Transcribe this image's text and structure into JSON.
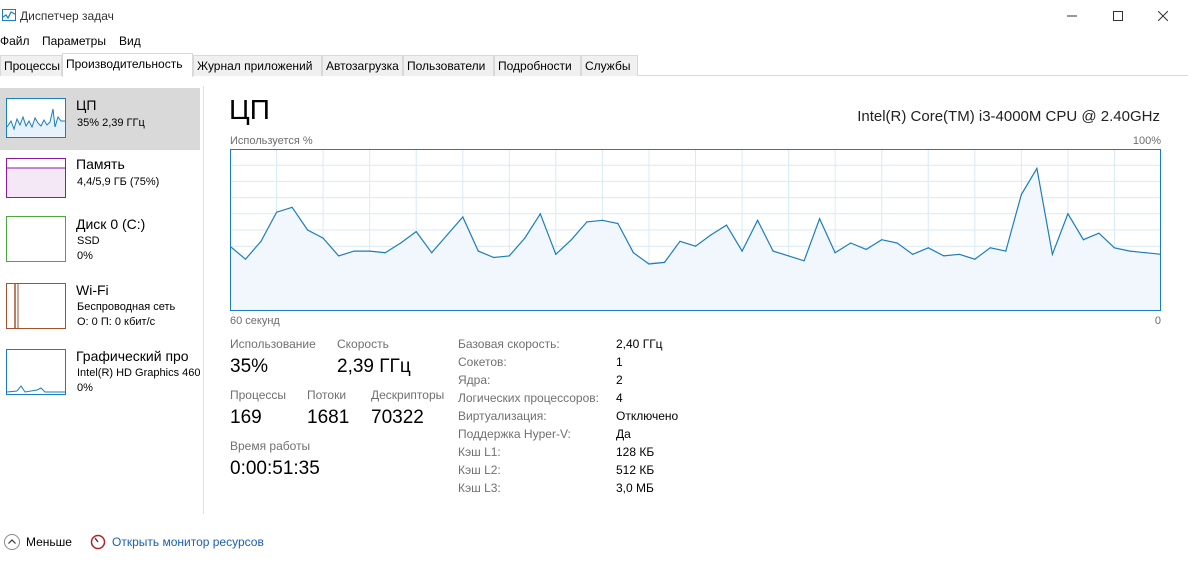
{
  "window": {
    "title": "Диспетчер задач",
    "app_icon": "task-manager-icon",
    "controls": [
      "minimize-icon",
      "maximize-icon",
      "close-icon"
    ]
  },
  "menu": [
    "Файл",
    "Параметры",
    "Вид"
  ],
  "tabs": [
    {
      "label": "Процессы",
      "active": false
    },
    {
      "label": "Производительность",
      "active": true
    },
    {
      "label": "Журнал приложений",
      "active": false
    },
    {
      "label": "Автозагрузка",
      "active": false
    },
    {
      "label": "Пользователи",
      "active": false
    },
    {
      "label": "Подробности",
      "active": false
    },
    {
      "label": "Службы",
      "active": false
    }
  ],
  "sidebar": [
    {
      "name": "ЦП",
      "line1": "35% 2,39 ГГц",
      "line2": "",
      "color": "#1b7dbf"
    },
    {
      "name": "Память",
      "line1": "4,4/5,9 ГБ (75%)",
      "line2": "",
      "color": "#8b1b9e"
    },
    {
      "name": "Диск 0 (C:)",
      "line1": "SSD",
      "line2": "0%",
      "color": "#4fa83d"
    },
    {
      "name": "Wi-Fi",
      "line1": "Беспроводная сеть",
      "line2": "О: 0 П: 0 кбит/с",
      "color": "#a0522d"
    },
    {
      "name": "Графический про",
      "line1": "Intel(R) HD Graphics 460",
      "line2": "0%",
      "color": "#1b7dbf"
    }
  ],
  "main": {
    "title": "ЦП",
    "cpu_name": "Intel(R) Core(TM) i3-4000M CPU @ 2.40GHz",
    "chart_top_left": "Используется %",
    "chart_top_right": "100%",
    "chart_bottom_left": "60 секунд",
    "chart_bottom_right": "0"
  },
  "stats": {
    "usage_label": "Использование",
    "usage_value": "35%",
    "speed_label": "Скорость",
    "speed_value": "2,39 ГГц",
    "processes_label": "Процессы",
    "processes_value": "169",
    "threads_label": "Потоки",
    "threads_value": "1681",
    "handles_label": "Дескрипторы",
    "handles_value": "70322",
    "uptime_label": "Время работы",
    "uptime_value": "0:00:51:35"
  },
  "specs": [
    {
      "label": "Базовая скорость:",
      "value": "2,40 ГГц"
    },
    {
      "label": "Сокетов:",
      "value": "1"
    },
    {
      "label": "Ядра:",
      "value": "2"
    },
    {
      "label": "Логических процессоров:",
      "value": "4"
    },
    {
      "label": "Виртуализация:",
      "value": "Отключено"
    },
    {
      "label": "Поддержка Hyper-V:",
      "value": "Да"
    },
    {
      "label": "Кэш L1:",
      "value": "128 КБ"
    },
    {
      "label": "Кэш L2:",
      "value": "512 КБ"
    },
    {
      "label": "Кэш L3:",
      "value": "3,0 МБ"
    }
  ],
  "footer": {
    "less_label": "Меньше",
    "resource_monitor_label": "Открыть монитор ресурсов"
  },
  "chart_data": {
    "type": "area",
    "xlim": [
      60,
      0
    ],
    "ylim": [
      0,
      100
    ],
    "grid": true,
    "color": "#1b7dbf",
    "x": [
      60,
      59,
      58,
      57,
      56,
      55,
      54,
      53,
      52,
      51,
      50,
      49,
      48,
      47,
      46,
      45,
      44,
      43,
      42,
      41,
      40,
      39,
      38,
      37,
      36,
      35,
      34,
      33,
      32,
      31,
      30,
      29,
      28,
      27,
      26,
      25,
      24,
      23,
      22,
      21,
      20,
      19,
      18,
      17,
      16,
      15,
      14,
      13,
      12,
      11,
      10,
      9,
      8,
      7,
      6,
      5,
      4,
      3,
      2,
      1,
      0
    ],
    "values": [
      40,
      32,
      43,
      61,
      64,
      50,
      45,
      34,
      37,
      37,
      36,
      42,
      49,
      36,
      47,
      58,
      37,
      33,
      34,
      45,
      60,
      35,
      44,
      55,
      56,
      54,
      36,
      29,
      30,
      43,
      40,
      47,
      53,
      37,
      56,
      37,
      34,
      31,
      57,
      36,
      42,
      38,
      44,
      42,
      35,
      39,
      34,
      35,
      32,
      39,
      37,
      72,
      88,
      35,
      60,
      44,
      48,
      39,
      37,
      36,
      35
    ],
    "series": [
      {
        "values": [
          40,
          32,
          43,
          61,
          64,
          50,
          45,
          34,
          37,
          37,
          36,
          42,
          49,
          36,
          47,
          58,
          37,
          33,
          34,
          45,
          60,
          35,
          44,
          55,
          56,
          54,
          36,
          29,
          30,
          43,
          40,
          47,
          53,
          37,
          56,
          37,
          34,
          31,
          57,
          36,
          42,
          38,
          44,
          42,
          35,
          39,
          34,
          35,
          32,
          39,
          37,
          72,
          88,
          35,
          60,
          44,
          48,
          39,
          37,
          36,
          35
        ]
      }
    ],
    "xlabel": "60 секунд",
    "ylabel": "Используется %"
  }
}
